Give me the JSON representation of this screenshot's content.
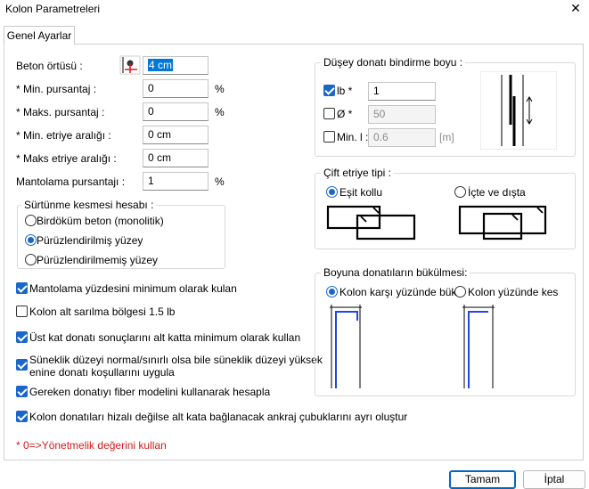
{
  "window": {
    "title": "Kolon Parametreleri",
    "close_glyph": "✕"
  },
  "tab": {
    "label": "Genel Ayarlar"
  },
  "params": {
    "beton_ortusu": {
      "label": "Beton örtüsü :",
      "value": "4 cm"
    },
    "min_pursantaj": {
      "label": "* Min.  pursantaj :",
      "value": "0",
      "unit": "%"
    },
    "maks_pursantaj": {
      "label": "* Maks. pursantaj :",
      "value": "0",
      "unit": "%"
    },
    "min_etriye": {
      "label": "* Min. etriye aralığı :",
      "value": "0 cm"
    },
    "maks_etriye": {
      "label": "* Maks etriye aralığı :",
      "value": "0 cm"
    },
    "mantolama": {
      "label": "Mantolama pursantajı :",
      "value": "1",
      "unit": "%"
    }
  },
  "surtunme": {
    "title": "Sürtünme kesmesi hesabı :",
    "options": [
      {
        "label": "Birdöküm beton (monolitik)",
        "selected": false
      },
      {
        "label": "Pürüzlendirilmiş yüzey",
        "selected": true
      },
      {
        "label": "Pürüzlendirilmemiş yüzey",
        "selected": false
      }
    ]
  },
  "checks": [
    {
      "label": "Mantolama yüzdesini minimum olarak kulan",
      "checked": true
    },
    {
      "label": "Kolon alt sarılma bölgesi 1.5 lb",
      "checked": false
    },
    {
      "label": "Üst kat donatı sonuçlarını alt katta minimum olarak kullan",
      "checked": true
    },
    {
      "label": "Süneklik düzeyi normal/sınırlı olsa bile süneklik düzeyi yüksek",
      "label2": "enine donatı koşullarını uygula",
      "checked": true
    },
    {
      "label": "Gereken donatıyı fiber modelini kullanarak hesapla",
      "checked": true
    },
    {
      "label": "Kolon donatıları hizalı değilse alt kata bağlanacak ankraj çubuklarını ayrı oluştur",
      "checked": true
    }
  ],
  "bindirme": {
    "title": "Düşey donatı bindirme boyu :",
    "lb": {
      "label": "lb *",
      "value": "1",
      "checked": true
    },
    "phi": {
      "label": "Ø *",
      "value": "50",
      "checked": false
    },
    "min_l": {
      "label": "Min. l :",
      "value": "0.6",
      "unit": "[m]",
      "checked": false
    }
  },
  "cift_etriye": {
    "title": "Çift etriye tipi :",
    "options": [
      {
        "label": "Eşit kollu",
        "selected": true
      },
      {
        "label": "İçte ve dışta",
        "selected": false
      }
    ]
  },
  "bukulme": {
    "title": "Boyuna donatıların bükülmesi:",
    "options": [
      {
        "label": "Kolon karşı yüzünde bük",
        "selected": true
      },
      {
        "label": "Kolon yüzünde kes",
        "selected": false
      }
    ]
  },
  "note": "* 0=>Yönetmelik değerini kullan",
  "buttons": {
    "ok": "Tamam",
    "cancel": "İptal"
  },
  "colors": {
    "accent": "#1a66c9",
    "note": "#d41a1a",
    "selection": "#0078d7"
  }
}
